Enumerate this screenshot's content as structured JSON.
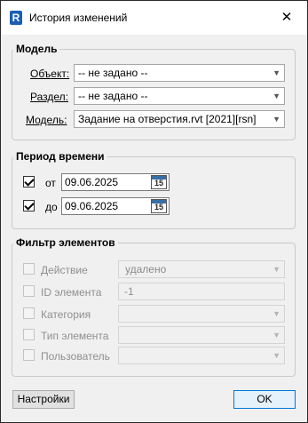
{
  "window": {
    "title": "История изменений",
    "app_icon_letter": "R"
  },
  "model": {
    "legend": "Модель",
    "object_label": "Объект:",
    "object_value": "-- не задано --",
    "section_label": "Раздел:",
    "section_value": "-- не задано --",
    "model_label": "Модель:",
    "model_value": "Задание на отверстия.rvt [2021][rsn]"
  },
  "period": {
    "legend": "Период времени",
    "from_label": "от",
    "from_date": "09.06.2025",
    "from_checked": true,
    "to_label": "до",
    "to_date": "09.06.2025",
    "to_checked": true,
    "calendar_day": "15"
  },
  "filter": {
    "legend": "Фильтр элементов",
    "action_label": "Действие",
    "action_value": "удалено",
    "id_label": "ID элемента",
    "id_value": "-1",
    "category_label": "Категория",
    "category_value": "",
    "type_label": "Тип элемента",
    "type_value": "",
    "user_label": "Пользователь",
    "user_value": ""
  },
  "buttons": {
    "settings": "Настройки",
    "ok": "OK"
  }
}
